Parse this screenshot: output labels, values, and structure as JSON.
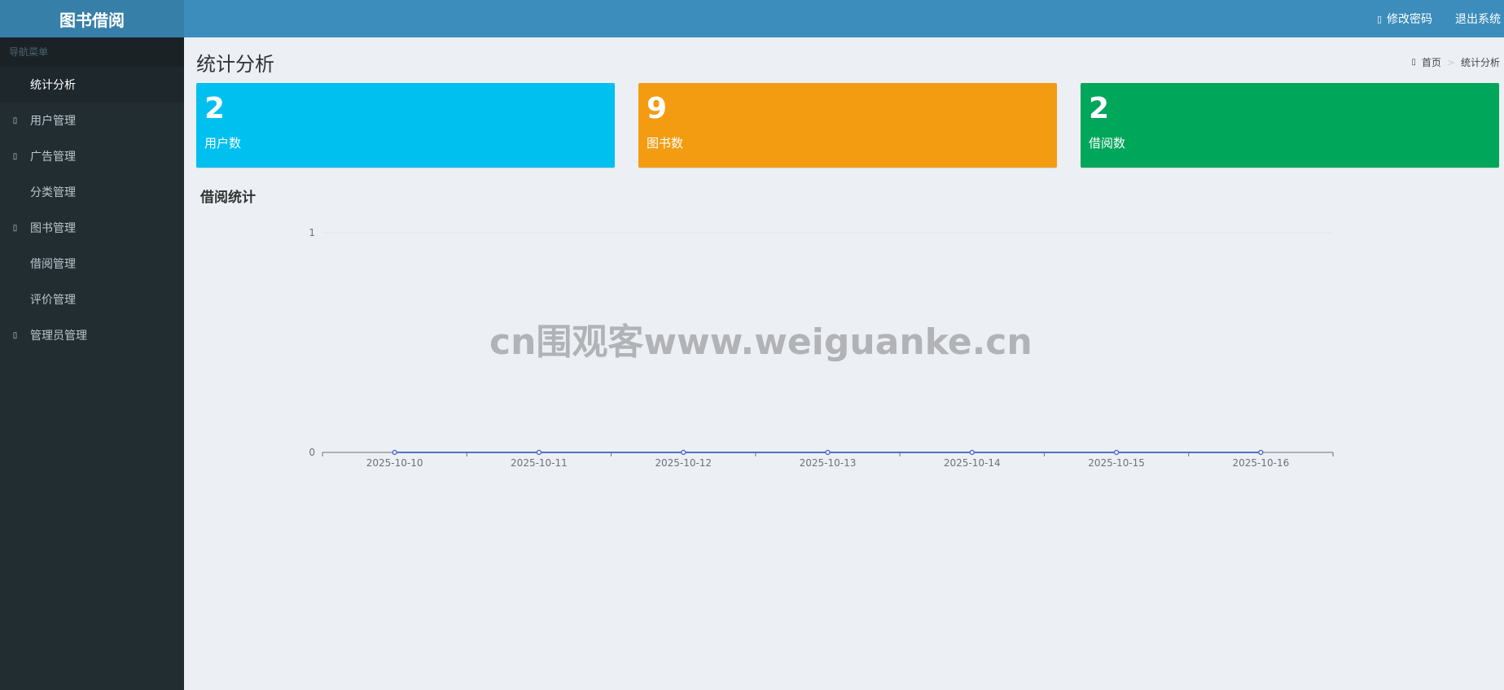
{
  "header": {
    "logo": "图书借阅",
    "change_password": "修改密码",
    "logout": "退出系统"
  },
  "sidebar": {
    "menu_header": "导航菜单",
    "items": [
      {
        "label": "统计分析",
        "icon": "none",
        "active": true
      },
      {
        "label": "用户管理",
        "icon": "user-icon",
        "active": false
      },
      {
        "label": "广告管理",
        "icon": "ad-icon",
        "active": false
      },
      {
        "label": "分类管理",
        "icon": "none",
        "active": false
      },
      {
        "label": "图书管理",
        "icon": "book-icon",
        "active": false
      },
      {
        "label": "借阅管理",
        "icon": "none",
        "active": false
      },
      {
        "label": "评价管理",
        "icon": "none",
        "active": false
      },
      {
        "label": "管理员管理",
        "icon": "admin-icon",
        "active": false
      }
    ]
  },
  "main": {
    "title": "统计分析",
    "breadcrumb": {
      "home": "首页",
      "current": "统计分析"
    },
    "stats": [
      {
        "value": "2",
        "label": "用户数",
        "color": "#00c0ef"
      },
      {
        "value": "9",
        "label": "图书数",
        "color": "#f39c12"
      },
      {
        "value": "2",
        "label": "借阅数",
        "color": "#00a65a"
      }
    ],
    "chart_title": "借阅统计"
  },
  "watermark": "cn围观客www.weiguanke.cn",
  "chart_data": {
    "type": "line",
    "x": [
      "2025-10-10",
      "2025-10-11",
      "2025-10-12",
      "2025-10-13",
      "2025-10-14",
      "2025-10-15",
      "2025-10-16"
    ],
    "series": [
      {
        "values": [
          0,
          0,
          0,
          0,
          0,
          0,
          0
        ],
        "color": "#5470c6"
      }
    ],
    "ylim": [
      0,
      1
    ],
    "yticks": [
      0,
      1
    ],
    "grid": true
  }
}
